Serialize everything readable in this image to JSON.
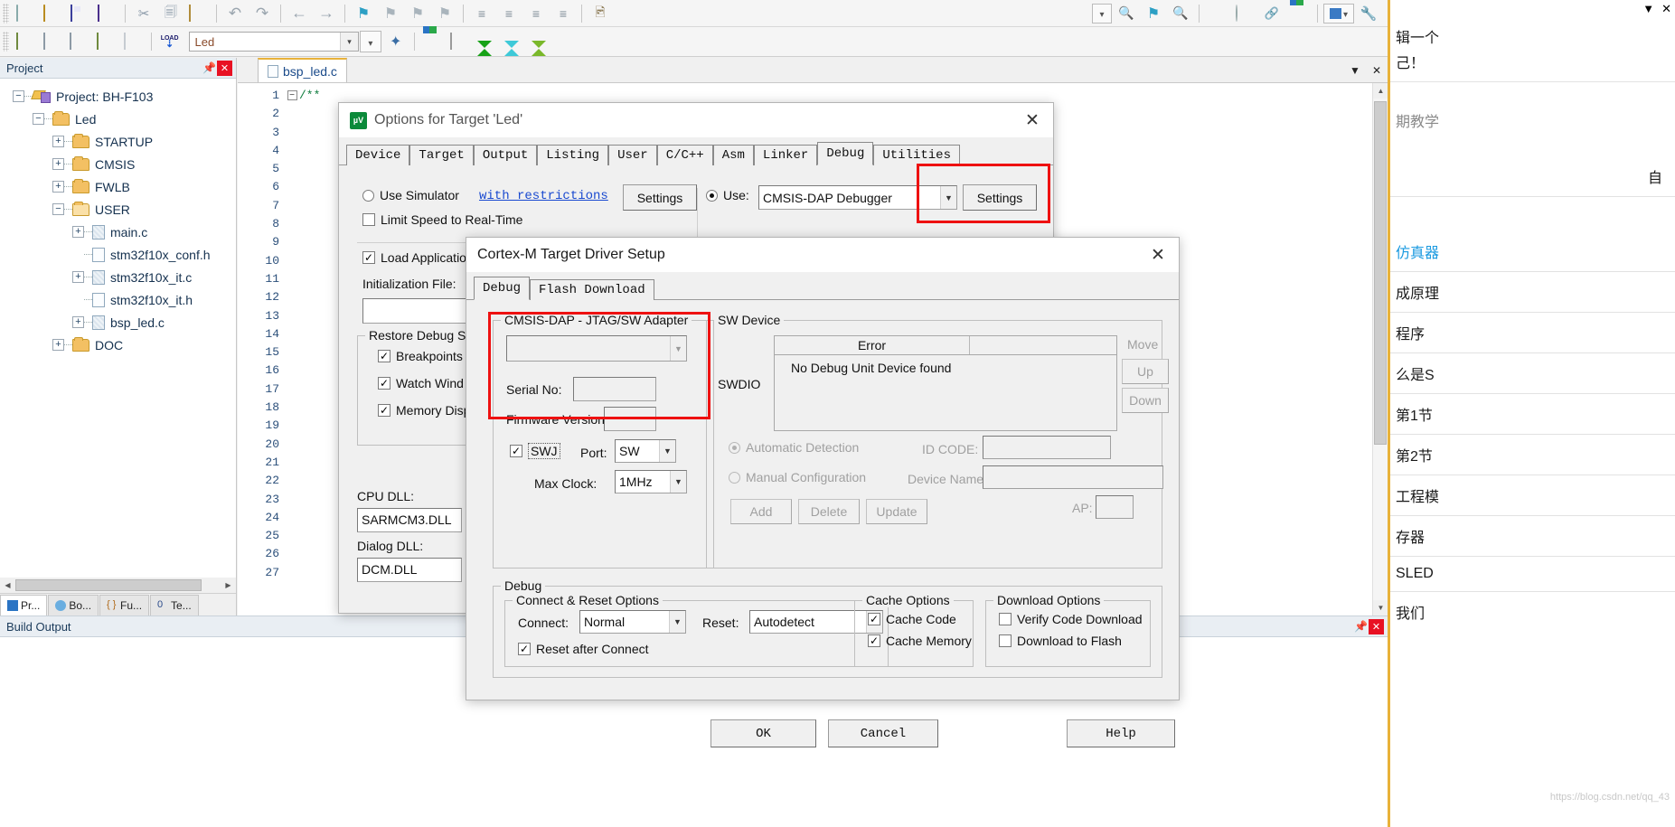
{
  "app": {
    "toolbar_target_value": "Led"
  },
  "toolbar": {
    "icons_row1": [
      "new-file-icon",
      "open-folder-icon",
      "save-icon",
      "save-all-icon",
      "cut-icon",
      "copy-icon",
      "paste-icon",
      "undo-icon",
      "redo-icon",
      "navigate-back-icon",
      "navigate-forward-icon",
      "bookmark-icon",
      "prev-bookmark-icon",
      "next-bookmark-icon",
      "clear-bookmarks-icon",
      "indent-icon",
      "outdent-icon",
      "comment-icon",
      "uncomment-icon",
      "camera-icon",
      "dropdown-icon",
      "find-in-files-icon",
      "bookmark2-icon",
      "magnifier-icon",
      "record-icon",
      "stop-icon",
      "link-icon",
      "insert-icon",
      "window-icon",
      "configure-icon"
    ],
    "icons_row2": [
      "translate-icon",
      "build-icon",
      "rebuild-icon",
      "batch-build-icon",
      "stop-build-icon",
      "load-icon",
      "target-options-icon",
      "magic-wand-icon",
      "manage-components-icon",
      "multi-project-icon",
      "pack-installer-icon",
      "diamond-icon",
      "gem-icon"
    ],
    "load_label": "LOAD"
  },
  "project_panel": {
    "title": "Project",
    "pin_icon": "pin-icon",
    "close_icon": "close-icon",
    "tree": [
      {
        "label": "Project: BH-F103",
        "depth": 0,
        "expander": "-",
        "icon": "project-icon"
      },
      {
        "label": "Led",
        "depth": 1,
        "expander": "-",
        "icon": "target-folder-icon"
      },
      {
        "label": "STARTUP",
        "depth": 2,
        "expander": "+",
        "icon": "folder-icon"
      },
      {
        "label": "CMSIS",
        "depth": 2,
        "expander": "+",
        "icon": "folder-icon"
      },
      {
        "label": "FWLB",
        "depth": 2,
        "expander": "+",
        "icon": "folder-icon"
      },
      {
        "label": "USER",
        "depth": 2,
        "expander": "-",
        "icon": "folder-open-icon"
      },
      {
        "label": "main.c",
        "depth": 3,
        "expander": "+",
        "icon": "c-file-icon"
      },
      {
        "label": "stm32f10x_conf.h",
        "depth": 3,
        "expander": "",
        "icon": "h-file-icon"
      },
      {
        "label": "stm32f10x_it.c",
        "depth": 3,
        "expander": "+",
        "icon": "c-file-icon"
      },
      {
        "label": "stm32f10x_it.h",
        "depth": 3,
        "expander": "",
        "icon": "h-file-icon"
      },
      {
        "label": "bsp_led.c",
        "depth": 3,
        "expander": "+",
        "icon": "c-file-icon"
      },
      {
        "label": "DOC",
        "depth": 2,
        "expander": "+",
        "icon": "folder-icon"
      }
    ],
    "tabs": [
      {
        "label": "Pr...",
        "icon": "project-tab-icon",
        "active": true
      },
      {
        "label": "Bo...",
        "icon": "books-tab-icon",
        "active": false
      },
      {
        "label": "Fu...",
        "icon": "functions-tab-icon",
        "active": false
      },
      {
        "label": "Te...",
        "icon": "templates-tab-icon",
        "active": false
      }
    ]
  },
  "editor": {
    "tab_label": "bsp_led.c",
    "tab_icon": "c-file-icon",
    "minimize_icon": "chevron-down-icon",
    "close_icon": "close-icon",
    "line_numbers": [
      "1",
      "2",
      "3",
      "4",
      "5",
      "6",
      "7",
      "8",
      "9",
      "10",
      "11",
      "12",
      "13",
      "14",
      "15",
      "16",
      "17",
      "18",
      "19",
      "20",
      "21",
      "22",
      "23",
      "24",
      "25",
      "26",
      "27"
    ],
    "code_first_line": "/**"
  },
  "build_output": {
    "title": "Build Output",
    "pin_icon": "pin-icon",
    "close_icon": "close-icon"
  },
  "options_dialog": {
    "title": "Options for Target 'Led'",
    "icon": "keil-icon",
    "close_icon": "close-icon",
    "tabs": [
      {
        "label": "Device",
        "selected": false
      },
      {
        "label": "Target",
        "selected": false
      },
      {
        "label": "Output",
        "selected": false
      },
      {
        "label": "Listing",
        "selected": false
      },
      {
        "label": "User",
        "selected": false
      },
      {
        "label": "C/C++",
        "selected": false
      },
      {
        "label": "Asm",
        "selected": false
      },
      {
        "label": "Linker",
        "selected": false
      },
      {
        "label": "Debug",
        "selected": true
      },
      {
        "label": "Utilities",
        "selected": false
      }
    ],
    "use_simulator_label": "Use Simulator",
    "with_restrictions_link": "with restrictions",
    "simulator_settings_button": "Settings",
    "limit_speed_label": "Limit Speed to Real-Time",
    "use_label": "Use:",
    "debugger_value": "CMSIS-DAP Debugger",
    "debugger_settings_button": "Settings",
    "load_application_label": "Load Application",
    "initialization_file_label": "Initialization File:",
    "initialization_file_value": "",
    "restore_debug_group": "Restore Debug S",
    "restore_items": [
      "Breakpoints",
      "Watch Wind",
      "Memory Disp"
    ],
    "cpu_dll_label": "CPU DLL:",
    "cpu_dll_value": "SARMCM3.DLL",
    "dialog_dll_label": "Dialog DLL:",
    "dialog_dll_value": "DCM.DLL"
  },
  "driver_dialog": {
    "title": "Cortex-M Target Driver Setup",
    "close_icon": "close-icon",
    "tabs": [
      {
        "label": "Debug",
        "selected": true
      },
      {
        "label": "Flash Download",
        "selected": false
      }
    ],
    "adapter_group": {
      "label": "CMSIS-DAP - JTAG/SW Adapter",
      "adapter_value": "",
      "serial_no_label": "Serial No:",
      "serial_no_value": "",
      "firmware_version_label": "Firmware Version:",
      "firmware_version_value": "",
      "swj_label": "SWJ",
      "swj_checked": true,
      "port_label": "Port:",
      "port_value": "SW",
      "max_clock_label": "Max Clock:",
      "max_clock_value": "1MHz"
    },
    "sw_device_group": {
      "label": "SW Device",
      "swdio_label": "SWDIO",
      "columns": [
        "Error",
        ""
      ],
      "rows": [
        "No Debug Unit Device found"
      ],
      "move_label": "Move",
      "up_button": "Up",
      "down_button": "Down",
      "automatic_detection_label": "Automatic Detection",
      "automatic_detection_selected": true,
      "manual_configuration_label": "Manual Configuration",
      "id_code_label": "ID CODE:",
      "id_code_value": "",
      "device_name_label": "Device Name:",
      "device_name_value": "",
      "ap_label": "AP:",
      "ap_value": "",
      "add_button": "Add",
      "delete_button": "Delete",
      "update_button": "Update"
    },
    "debug_group": {
      "label": "Debug",
      "connect_reset_group": "Connect & Reset Options",
      "connect_label": "Connect:",
      "connect_value": "Normal",
      "reset_label": "Reset:",
      "reset_value": "Autodetect",
      "reset_after_connect_label": "Reset after Connect",
      "reset_after_connect_checked": true,
      "cache_options_group": "Cache Options",
      "cache_code_label": "Cache Code",
      "cache_code_checked": true,
      "cache_memory_label": "Cache Memory",
      "cache_memory_checked": true,
      "download_options_group": "Download Options",
      "verify_code_download_label": "Verify Code Download",
      "verify_code_download_checked": false,
      "download_to_flash_label": "Download to Flash",
      "download_to_flash_checked": false
    },
    "ok_button": "OK",
    "cancel_button": "Cancel",
    "help_button": "Help"
  },
  "right_pane": {
    "lines": [
      "辑一个",
      "己！",
      "期教学",
      "自",
      "仿真器",
      "成原理",
      "程序",
      "么是S",
      "第1节",
      "第2节",
      "工程模",
      "存器",
      "SLED",
      "我们"
    ],
    "watermark": "https://blog.csdn.net/qq_43"
  }
}
